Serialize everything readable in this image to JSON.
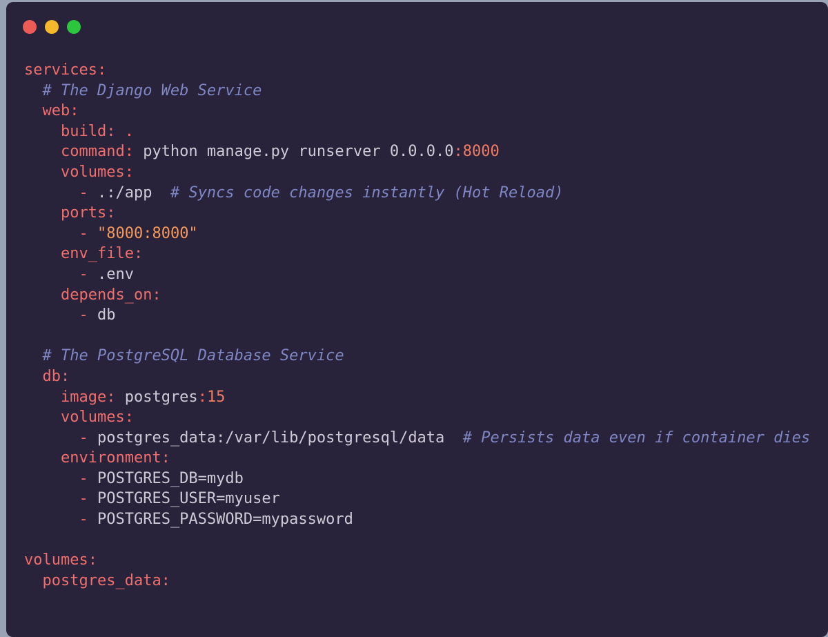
{
  "window": {
    "traffic_lights": [
      {
        "name": "close",
        "color": "#ed5b57"
      },
      {
        "name": "minimize",
        "color": "#f6b92b"
      },
      {
        "name": "maximize",
        "color": "#2bc63e"
      }
    ]
  },
  "colors": {
    "background": "#29223b",
    "key": "#ef6f6c",
    "plain": "#cfcbd6",
    "number": "#f07b62",
    "string": "#f4995a",
    "comment": "#7f86c4"
  },
  "code": {
    "language": "yaml",
    "lines": [
      [
        {
          "t": "key",
          "v": "services:"
        }
      ],
      [
        {
          "t": "plain",
          "v": "  "
        },
        {
          "t": "comment",
          "v": "# The Django Web Service"
        }
      ],
      [
        {
          "t": "plain",
          "v": "  "
        },
        {
          "t": "key",
          "v": "web:"
        }
      ],
      [
        {
          "t": "plain",
          "v": "    "
        },
        {
          "t": "key",
          "v": "build: ."
        }
      ],
      [
        {
          "t": "plain",
          "v": "    "
        },
        {
          "t": "key",
          "v": "command:"
        },
        {
          "t": "plain",
          "v": " python manage.py runserver 0.0.0.0"
        },
        {
          "t": "key",
          "v": ":"
        },
        {
          "t": "num",
          "v": "8000"
        }
      ],
      [
        {
          "t": "plain",
          "v": "    "
        },
        {
          "t": "key",
          "v": "volumes:"
        }
      ],
      [
        {
          "t": "plain",
          "v": "      "
        },
        {
          "t": "key",
          "v": "-"
        },
        {
          "t": "plain",
          "v": " .:/app  "
        },
        {
          "t": "comment",
          "v": "# Syncs code changes instantly (Hot Reload)"
        }
      ],
      [
        {
          "t": "plain",
          "v": "    "
        },
        {
          "t": "key",
          "v": "ports:"
        }
      ],
      [
        {
          "t": "plain",
          "v": "      "
        },
        {
          "t": "key",
          "v": "-"
        },
        {
          "t": "plain",
          "v": " "
        },
        {
          "t": "str",
          "v": "\"8000:8000\""
        }
      ],
      [
        {
          "t": "plain",
          "v": "    "
        },
        {
          "t": "key",
          "v": "env_file:"
        }
      ],
      [
        {
          "t": "plain",
          "v": "      "
        },
        {
          "t": "key",
          "v": "-"
        },
        {
          "t": "plain",
          "v": " .env"
        }
      ],
      [
        {
          "t": "plain",
          "v": "    "
        },
        {
          "t": "key",
          "v": "depends_on:"
        }
      ],
      [
        {
          "t": "plain",
          "v": "      "
        },
        {
          "t": "key",
          "v": "-"
        },
        {
          "t": "plain",
          "v": " db"
        }
      ],
      [],
      [
        {
          "t": "plain",
          "v": "  "
        },
        {
          "t": "comment",
          "v": "# The PostgreSQL Database Service"
        }
      ],
      [
        {
          "t": "plain",
          "v": "  "
        },
        {
          "t": "key",
          "v": "db:"
        }
      ],
      [
        {
          "t": "plain",
          "v": "    "
        },
        {
          "t": "key",
          "v": "image:"
        },
        {
          "t": "plain",
          "v": " postgres"
        },
        {
          "t": "key",
          "v": ":"
        },
        {
          "t": "num",
          "v": "15"
        }
      ],
      [
        {
          "t": "plain",
          "v": "    "
        },
        {
          "t": "key",
          "v": "volumes:"
        }
      ],
      [
        {
          "t": "plain",
          "v": "      "
        },
        {
          "t": "key",
          "v": "-"
        },
        {
          "t": "plain",
          "v": " postgres_data:/var/lib/postgresql/data  "
        },
        {
          "t": "comment",
          "v": "# Persists data even if container dies"
        }
      ],
      [
        {
          "t": "plain",
          "v": "    "
        },
        {
          "t": "key",
          "v": "environment:"
        }
      ],
      [
        {
          "t": "plain",
          "v": "      "
        },
        {
          "t": "key",
          "v": "-"
        },
        {
          "t": "plain",
          "v": " POSTGRES_DB=mydb"
        }
      ],
      [
        {
          "t": "plain",
          "v": "      "
        },
        {
          "t": "key",
          "v": "-"
        },
        {
          "t": "plain",
          "v": " POSTGRES_USER=myuser"
        }
      ],
      [
        {
          "t": "plain",
          "v": "      "
        },
        {
          "t": "key",
          "v": "-"
        },
        {
          "t": "plain",
          "v": " POSTGRES_PASSWORD=mypassword"
        }
      ],
      [],
      [
        {
          "t": "key",
          "v": "volumes:"
        }
      ],
      [
        {
          "t": "plain",
          "v": "  "
        },
        {
          "t": "key",
          "v": "postgres_data:"
        }
      ]
    ]
  }
}
